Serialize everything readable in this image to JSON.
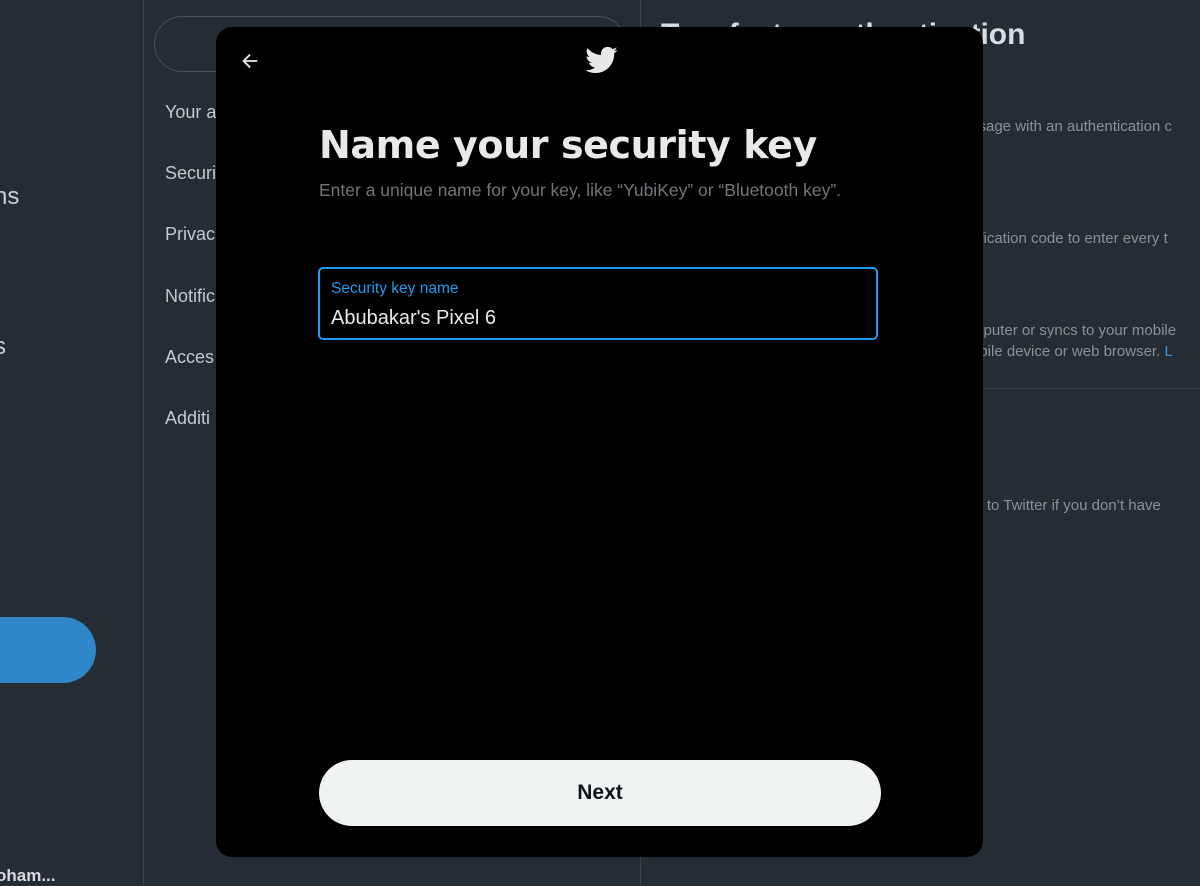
{
  "background": {
    "left_nav": {
      "items": [
        "ns",
        "s"
      ],
      "user_name": "oham..."
    },
    "settings_nav": {
      "items": [
        "Your a",
        "Securi",
        "Privac",
        "Notific",
        "Acces",
        "Additi"
      ]
    },
    "detail": {
      "title": "Two-factor authentication",
      "lines": [
        "ssage with an authentication c",
        "rification code to enter every t",
        "mputer or syncs to your mobile",
        "obile device or web browser.",
        "in to Twitter if you don’t have"
      ],
      "link_fragment": "L"
    }
  },
  "modal": {
    "back_icon": "arrow-left-icon",
    "logo_icon": "twitter-bird-icon",
    "title": "Name your security key",
    "subtitle": "Enter a unique name for your key, like “YubiKey” or “Bluetooth key”.",
    "field": {
      "label": "Security key name",
      "value": "Abubakar's Pixel 6"
    },
    "next_label": "Next"
  },
  "colors": {
    "accent": "#1d9bf0",
    "modal_bg": "#000000",
    "button_bg": "#eff3f4",
    "page_bg": "#262c33"
  }
}
